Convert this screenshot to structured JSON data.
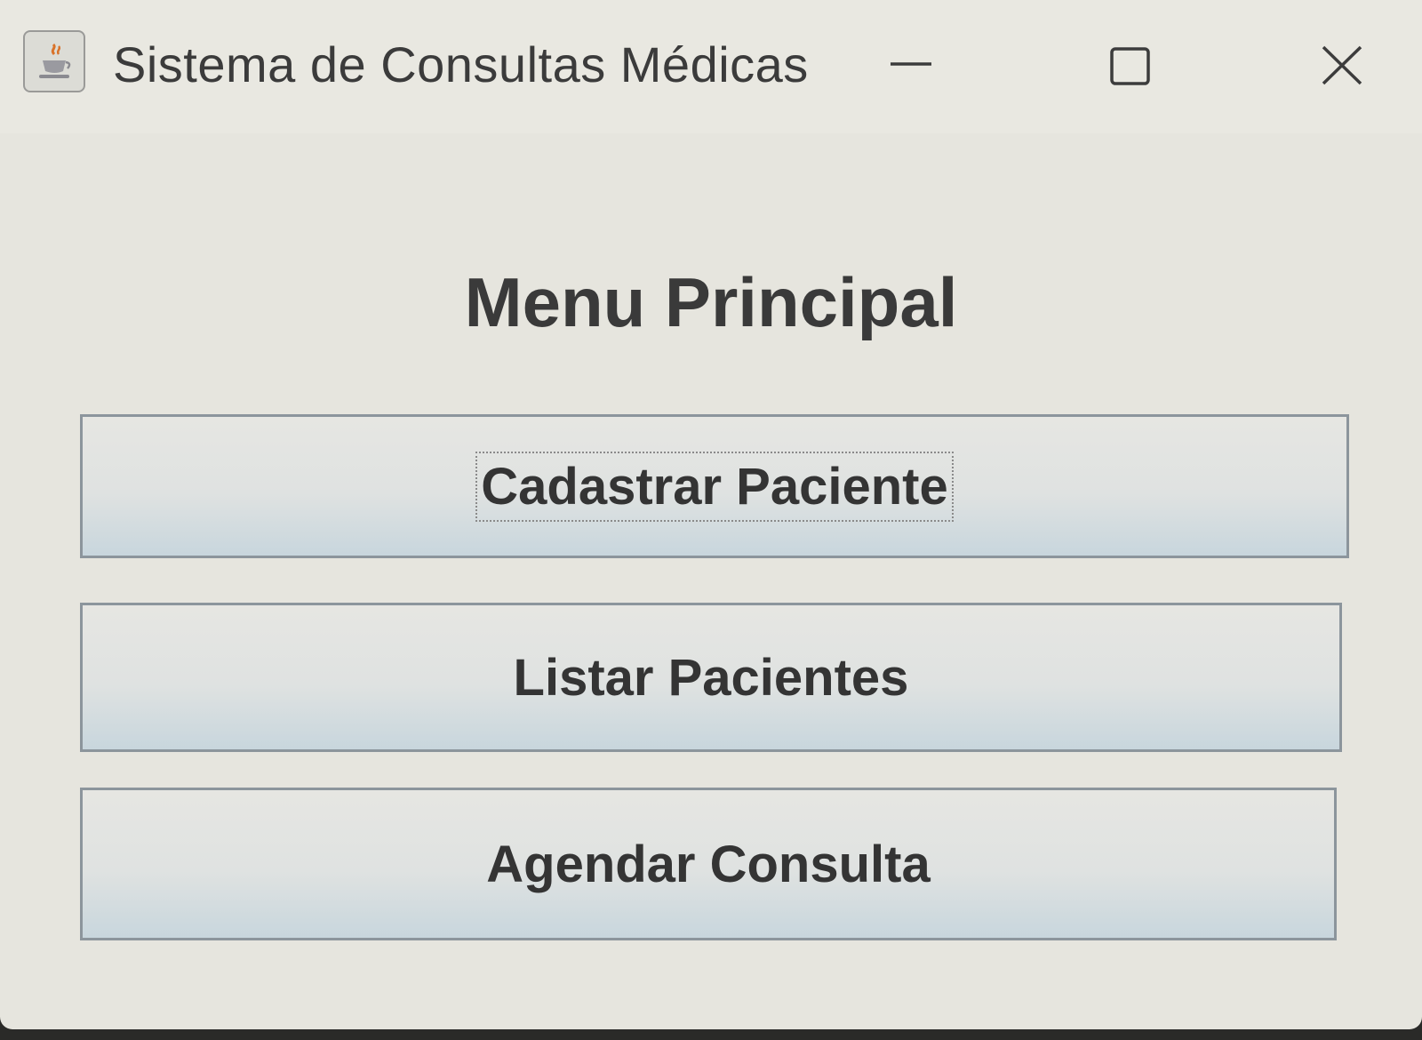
{
  "window": {
    "title": "Sistema de Consultas Médicas",
    "icon": "java-cup-icon",
    "controls": [
      "minimize-icon",
      "maximize-icon",
      "close-icon"
    ]
  },
  "main": {
    "heading": "Menu Principal",
    "buttons": [
      {
        "label": "Cadastrar Paciente",
        "focused": true
      },
      {
        "label": "Listar Pacientes",
        "focused": false
      },
      {
        "label": "Agendar Consulta",
        "focused": false
      }
    ]
  },
  "colors": {
    "window_bg": "#e6e5de",
    "button_border": "#8c959c",
    "text": "#3a3a3a"
  }
}
